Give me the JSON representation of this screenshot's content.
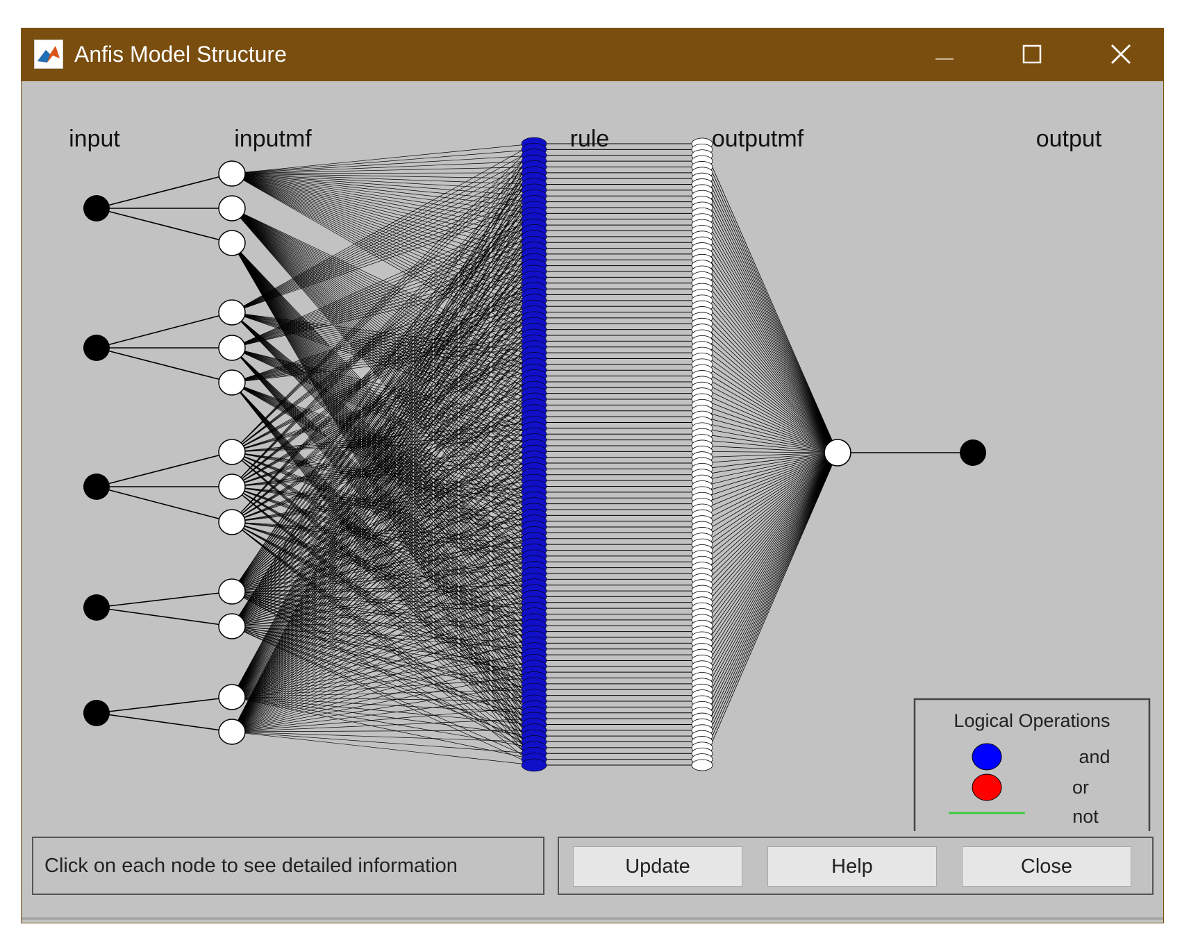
{
  "window": {
    "title": "Anfis Model Structure",
    "icon": "matlab-logo-icon",
    "controls": [
      "minimize-icon",
      "maximize-icon",
      "close-icon"
    ]
  },
  "diagram": {
    "layer_labels": {
      "input": "input",
      "inputmf": "inputmf",
      "rule": "rule",
      "outputmf": "outputmf",
      "output": "output"
    },
    "inputs": [
      {
        "mf_count": 3
      },
      {
        "mf_count": 3
      },
      {
        "mf_count": 3
      },
      {
        "mf_count": 2
      },
      {
        "mf_count": 2
      }
    ],
    "rule_count": 108,
    "rule_color": "#1010c8",
    "outputmf_count": 108,
    "output_count": 1
  },
  "legend": {
    "title": "Logical Operations",
    "items": [
      {
        "label": "and",
        "color": "#0000ff"
      },
      {
        "label": "or",
        "color": "#ff0000"
      },
      {
        "label": "not",
        "color": "#33cc33"
      }
    ]
  },
  "status": {
    "text": "Click on each node to see detailed information"
  },
  "buttons": {
    "update": "Update",
    "help": "Help",
    "close": "Close"
  },
  "colors": {
    "titlebar": "#7a4e0e",
    "background": "#c2c2c2"
  }
}
